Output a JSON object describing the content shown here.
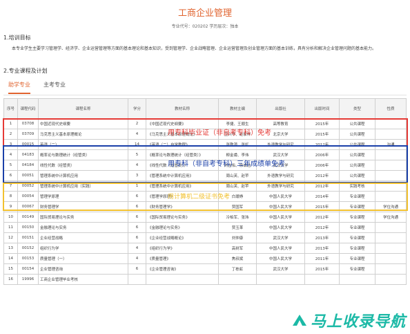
{
  "header": {
    "title": "工商企业管理",
    "subtitle": "专业代号：020202 学历层次：独本"
  },
  "sections": {
    "goal_title": "1.培训目标",
    "goal_text": "本专业学生主要学习管理学、经济学、企业运营管理等方面的基本理论和基本知识，受到管理学、企业战略管理、企业运营管理及创业管理方面的基本训练，具有分析和解决企业管理问题的基本能力。",
    "plan_title": "2.专业课程及计划"
  },
  "tabs": [
    {
      "label": "助学专业",
      "active": true
    },
    {
      "label": "主考专业",
      "active": false
    }
  ],
  "table": {
    "headers": [
      "序号",
      "课程代码",
      "课程名称",
      "学分",
      "教材名称",
      "教材主编",
      "出版社",
      "出版时间",
      "类型",
      "性质"
    ],
    "rows": [
      [
        "1",
        "03708",
        "中国近现代史纲要",
        "2",
        "《中国近现代史纲要》",
        "李捷、王顺生",
        "高等教育",
        "2015年",
        "公共课程",
        ""
      ],
      [
        "2",
        "03709",
        "马克思主义基本原理概论",
        "4",
        "《马克思主义基本原理概论》",
        "卫兴华、赵家祥",
        "北京大学",
        "2015年",
        "公共课程",
        ""
      ],
      [
        "3",
        "00015",
        "英语（二）",
        "14",
        "《英语（二）自学教程》",
        "张敬源、张虹",
        "外语教学与研究",
        "2012年",
        "公共课程",
        "沟通"
      ],
      [
        "4",
        "04183",
        "概率论与数理统计（经管类）",
        "5",
        "《概率论与数理统计（经管类）》",
        "柳金甫、李伟",
        "武汉大学",
        "2006年",
        "公共课程",
        ""
      ],
      [
        "5",
        "04184",
        "线性代数（经管类）",
        "4",
        "《线性代数（经管类）》",
        "刘吉佑、徐诚浩",
        "武汉大学",
        "2006年",
        "公共课程",
        ""
      ],
      [
        "6",
        "00051",
        "管理系统中计算机应用",
        "3",
        "《管理系统中计算机应用》",
        "周山芙、赵苹",
        "外语教学与研究",
        "2012年",
        "公共课程",
        ""
      ],
      [
        "7",
        "00052",
        "管理系统中计算机应用（实践）",
        "1",
        "《管理系统中计算机应用》",
        "周山芙、赵苹",
        "外语教学与研究",
        "2012年",
        "实践考核",
        ""
      ],
      [
        "8",
        "00054",
        "管理学原理",
        "6",
        "《管理学原理》",
        "白瑷峥",
        "中国人民大学",
        "2014年",
        "专业课程",
        ""
      ],
      [
        "9",
        "00067",
        "财务管理学",
        "6",
        "《财务管理学》",
        "贾国军",
        "中国人民大学",
        "2015年",
        "专业课程",
        "学位沟通"
      ],
      [
        "10",
        "00149",
        "国际贸易理论与实务",
        "6",
        "《国际贸易理论与实务》",
        "冷柏军、张玮",
        "中国人民大学",
        "2012年",
        "专业课程",
        "学位沟通"
      ],
      [
        "11",
        "00150",
        "金融理论与实务",
        "6",
        "《金融理论与实务》",
        "贾玉革",
        "中国人民大学",
        "2012年",
        "专业课程",
        ""
      ],
      [
        "12",
        "00151",
        "企业经营战略",
        "6",
        "《企业经营战略概论》",
        "刘仲康",
        "武汉大学",
        "2013年",
        "专业课程",
        ""
      ],
      [
        "13",
        "00152",
        "组织行为学",
        "4",
        "《组织行为学》",
        "高树军",
        "中国人民大学",
        "2013年",
        "专业课程",
        ""
      ],
      [
        "14",
        "00153",
        "质量管理（一）",
        "4",
        "《质量管理》",
        "焦叔斌",
        "中国人民大学",
        "2011年",
        "专业课程",
        ""
      ],
      [
        "15",
        "00154",
        "企业管理咨询",
        "6",
        "《企业管理咨询》",
        "丁栋虹",
        "武汉大学",
        "2015年",
        "专业课程",
        ""
      ],
      [
        "16",
        "19996",
        "工商企业管理毕业考核",
        "",
        "",
        "",
        "",
        "",
        "",
        ""
      ]
    ]
  },
  "annotations": {
    "red": "用专科毕业证（非自考专科）免考",
    "blue": "用专科（非自考专科）三年成绩单免考",
    "yellow": "用计算机二级证书免考"
  },
  "watermark": {
    "text": "马上收录导航"
  },
  "colors": {
    "accent": "#e0632e",
    "red_box": "#e53935",
    "blue_box": "#1a3fa8",
    "yellow_box": "#f2c12e",
    "watermark": "#1bb9a6"
  }
}
